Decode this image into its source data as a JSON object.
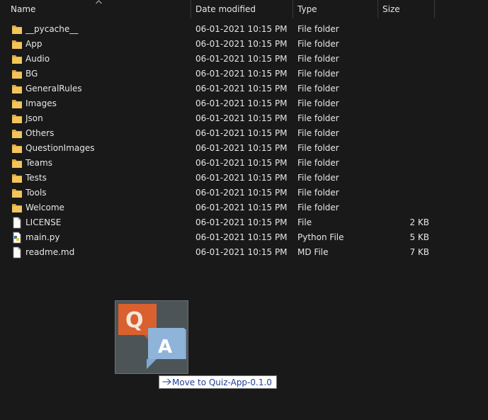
{
  "columns": {
    "name": "Name",
    "date": "Date modified",
    "type": "Type",
    "size": "Size"
  },
  "items": [
    {
      "name": "__pycache__",
      "date": "06-01-2021 10:15 PM",
      "type": "File folder",
      "size": "",
      "icon": "folder-icon"
    },
    {
      "name": "App",
      "date": "06-01-2021 10:15 PM",
      "type": "File folder",
      "size": "",
      "icon": "folder-icon"
    },
    {
      "name": "Audio",
      "date": "06-01-2021 10:15 PM",
      "type": "File folder",
      "size": "",
      "icon": "folder-icon"
    },
    {
      "name": "BG",
      "date": "06-01-2021 10:15 PM",
      "type": "File folder",
      "size": "",
      "icon": "folder-icon"
    },
    {
      "name": "GeneralRules",
      "date": "06-01-2021 10:15 PM",
      "type": "File folder",
      "size": "",
      "icon": "folder-icon"
    },
    {
      "name": "Images",
      "date": "06-01-2021 10:15 PM",
      "type": "File folder",
      "size": "",
      "icon": "folder-icon"
    },
    {
      "name": "Json",
      "date": "06-01-2021 10:15 PM",
      "type": "File folder",
      "size": "",
      "icon": "folder-icon"
    },
    {
      "name": "Others",
      "date": "06-01-2021 10:15 PM",
      "type": "File folder",
      "size": "",
      "icon": "folder-icon"
    },
    {
      "name": "QuestionImages",
      "date": "06-01-2021 10:15 PM",
      "type": "File folder",
      "size": "",
      "icon": "folder-icon"
    },
    {
      "name": "Teams",
      "date": "06-01-2021 10:15 PM",
      "type": "File folder",
      "size": "",
      "icon": "folder-icon"
    },
    {
      "name": "Tests",
      "date": "06-01-2021 10:15 PM",
      "type": "File folder",
      "size": "",
      "icon": "folder-icon"
    },
    {
      "name": "Tools",
      "date": "06-01-2021 10:15 PM",
      "type": "File folder",
      "size": "",
      "icon": "folder-icon"
    },
    {
      "name": "Welcome",
      "date": "06-01-2021 10:15 PM",
      "type": "File folder",
      "size": "",
      "icon": "folder-icon"
    },
    {
      "name": "LICENSE",
      "date": "06-01-2021 10:15 PM",
      "type": "File",
      "size": "2 KB",
      "icon": "file-icon"
    },
    {
      "name": "main.py",
      "date": "06-01-2021 10:15 PM",
      "type": "Python File",
      "size": "5 KB",
      "icon": "python-file-icon"
    },
    {
      "name": "readme.md",
      "date": "06-01-2021 10:15 PM",
      "type": "MD File",
      "size": "7 KB",
      "icon": "file-icon"
    }
  ],
  "drag": {
    "tooltip": "Move to Quiz-App-0.1.0",
    "thumbnail_icon": "quiz-app-qa-icon"
  },
  "colors": {
    "background": "#191919",
    "folder": "#f2c55c",
    "tooltip_text": "#1f3f9a",
    "q_bubble": "#c9542b",
    "a_bubble": "#8fb4d9"
  }
}
